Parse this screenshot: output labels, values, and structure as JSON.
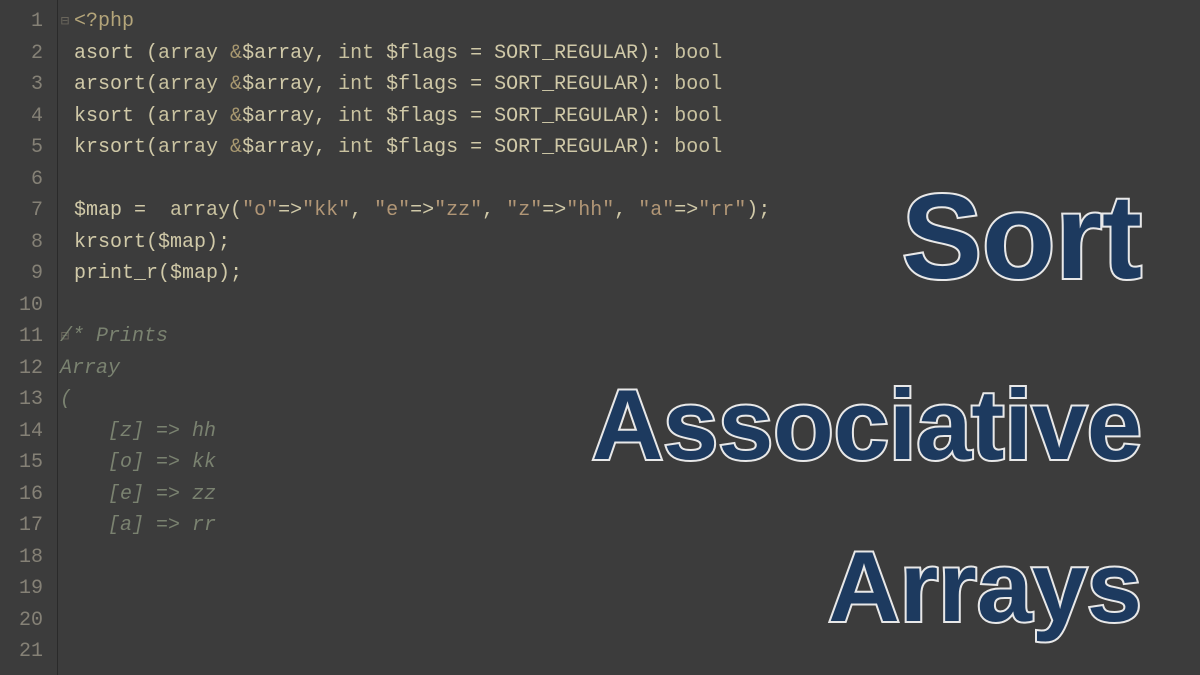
{
  "gutter": {
    "lines": [
      "1",
      "2",
      "3",
      "4",
      "5",
      "6",
      "7",
      "8",
      "9",
      "10",
      "11",
      "12",
      "13",
      "14",
      "15",
      "16",
      "17",
      "18",
      "19",
      "20",
      "21"
    ]
  },
  "fold": {
    "marks": {
      "0": "⊟",
      "10": "⊟"
    }
  },
  "code": {
    "l1_open": "<?",
    "l1_php": "php",
    "l2_func": "asort ",
    "l2_p1": "(",
    "l2_arr": "array ",
    "l2_amp": "&",
    "l2_var": "$array",
    "l2_c1": ", ",
    "l2_int": "int ",
    "l2_var2": "$flags",
    "l2_eq": " = ",
    "l2_const": "SORT_REGULAR",
    "l2_p2": ")",
    "l2_col": ": ",
    "l2_bool": "bool",
    "l3_func": "arsort",
    "l4_func": "ksort ",
    "l5_func": "krsort",
    "l7_var": "$map",
    "l7_eq": " =  ",
    "l7_arr": "array",
    "l7_p1": "(",
    "l7_s1": "\"o\"",
    "l7_arrow": "=>",
    "l7_s2": "\"kk\"",
    "l7_c": ", ",
    "l7_s3": "\"e\"",
    "l7_s4": "\"zz\"",
    "l7_s5": "\"z\"",
    "l7_s6": "\"hh\"",
    "l7_s7": "\"a\"",
    "l7_s8": "\"rr\"",
    "l7_p2": ")",
    "l7_semi": ";",
    "l8_func": "krsort",
    "l8_p1": "(",
    "l8_var": "$map",
    "l8_p2": ")",
    "l8_semi": ";",
    "l9_func": "print_r",
    "l9_p1": "(",
    "l9_var": "$map",
    "l9_p2": ")",
    "l9_semi": ";",
    "l11": "/* Prints",
    "l12": "Array",
    "l13": "(",
    "l14": "    [z] => hh",
    "l15": "    [o] => kk",
    "l16": "    [e] => zz",
    "l17": "    [a] => rr"
  },
  "overlay": {
    "sort": "Sort",
    "assoc": "Associative",
    "arrays": "Arrays"
  }
}
